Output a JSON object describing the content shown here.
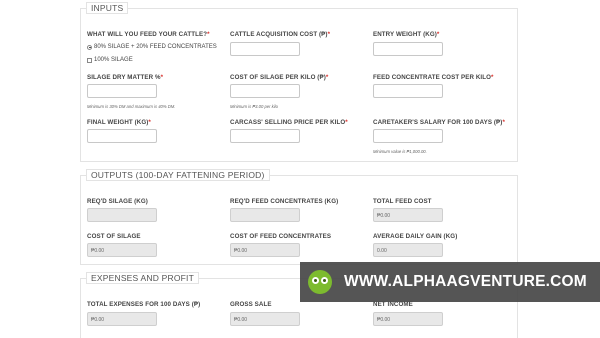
{
  "inputs": {
    "legend": "INPUTS",
    "feed_label": "WHAT WILL YOU FEED YOUR CATTLE?",
    "feed_options": [
      "80% SILAGE + 20% FEED CONCENTRATES",
      "100% SILAGE"
    ],
    "feed_selected": "80% SILAGE + 20% FEED CONCENTRATES",
    "acq_label": "CATTLE ACQUISITION COST (₱)",
    "entry_label": "ENTRY WEIGHT (KG)",
    "sdm_label": "SILAGE DRY MATTER %",
    "sdm_hint": "Minimum is 30% DM and maximum is 40% DM.",
    "sil_cost_label": "COST OF SILAGE PER KILO (₱)",
    "sil_cost_hint": "Minimum is ₱3.00 per kilo",
    "fc_cost_label": "FEED CONCENTRATE COST PER KILO",
    "final_label": "FINAL WEIGHT (KG)",
    "carcass_label": "CARCASS' SELLING PRICE PER KILO",
    "caretaker_label": "CARETAKER'S SALARY FOR 100 DAYS (₱)",
    "caretaker_hint": "Minimum value is ₱1,000.00.",
    "required_mark": "*"
  },
  "outputs": {
    "legend": "OUTPUTS (100-DAY FATTENING PERIOD)",
    "req_silage_label": "REQ'D SILAGE (KG)",
    "req_silage_value": "",
    "req_fc_label": "REQ'D FEED CONCENTRATES (KG)",
    "req_fc_value": "",
    "total_feed_label": "TOTAL FEED COST",
    "total_feed_value": "₱0.00",
    "cost_silage_label": "COST OF SILAGE",
    "cost_silage_value": "₱0.00",
    "cost_fc_label": "COST OF FEED CONCENTRATES",
    "cost_fc_value": "₱0.00",
    "adg_label": "AVERAGE DAILY GAIN (KG)",
    "adg_value": "0.00"
  },
  "expenses": {
    "legend": "EXPENSES AND PROFIT",
    "total_exp_label": "TOTAL EXPENSES FOR 100 DAYS (₱)",
    "total_exp_value": "₱0.00",
    "gross_label": "GROSS SALE",
    "gross_value": "₱0.00",
    "net_label": "NET INCOME",
    "net_value": "₱0.00"
  },
  "banner": {
    "text": "WWW.ALPHAAGVENTURE.COM",
    "logo_icon": "owl-eyes-logo-icon",
    "logo_color": "#7dbb2f"
  }
}
